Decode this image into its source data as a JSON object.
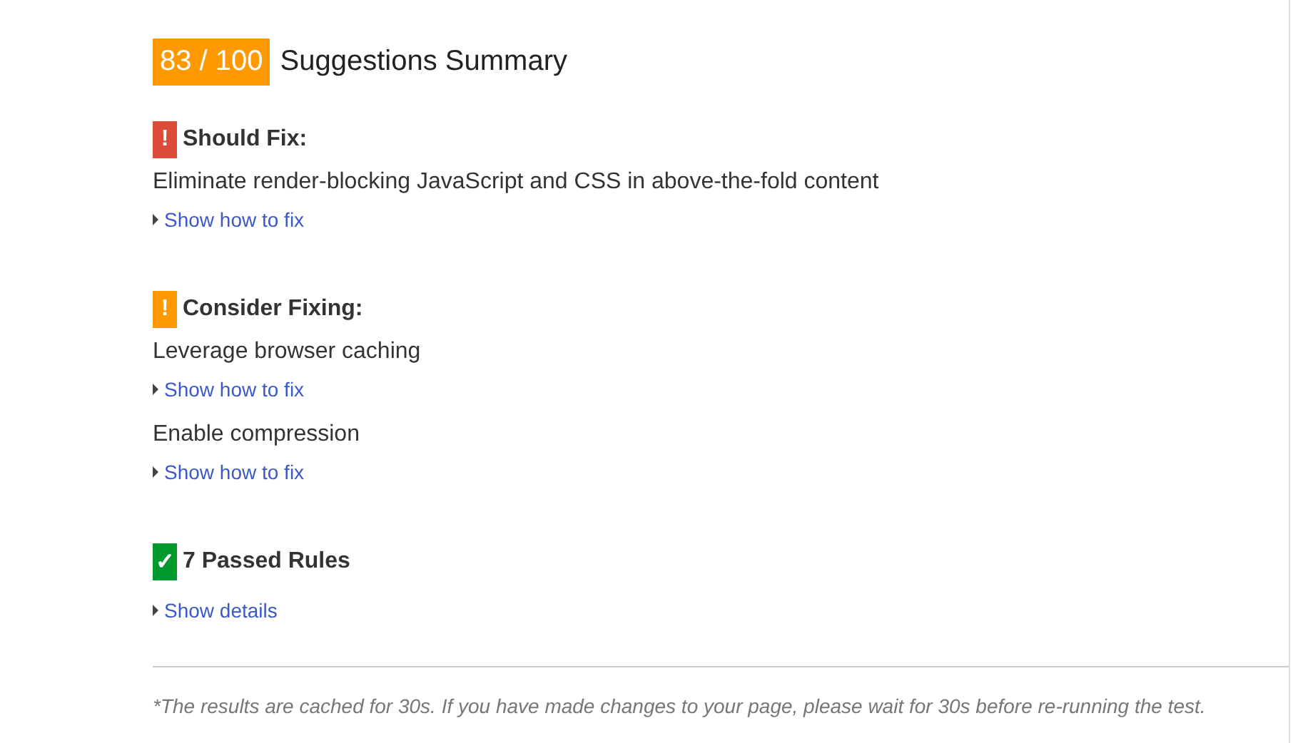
{
  "summary": {
    "score": "83 / 100",
    "title": "Suggestions Summary"
  },
  "sections": [
    {
      "kind": "error",
      "icon": "!",
      "heading": "Should Fix:",
      "rules": [
        {
          "text": "Eliminate render-blocking JavaScript and CSS in above-the-fold content",
          "link": "Show how to fix"
        }
      ]
    },
    {
      "kind": "warning",
      "icon": "!",
      "heading": "Consider Fixing:",
      "rules": [
        {
          "text": "Leverage browser caching",
          "link": "Show how to fix"
        },
        {
          "text": "Enable compression",
          "link": "Show how to fix"
        }
      ]
    },
    {
      "kind": "passed",
      "icon": "✓",
      "heading": "7 Passed Rules",
      "rules": [
        {
          "link": "Show details"
        }
      ]
    }
  ],
  "footnote": "*The results are cached for 30s. If you have made changes to your page, please wait for 30s before re-running the test."
}
